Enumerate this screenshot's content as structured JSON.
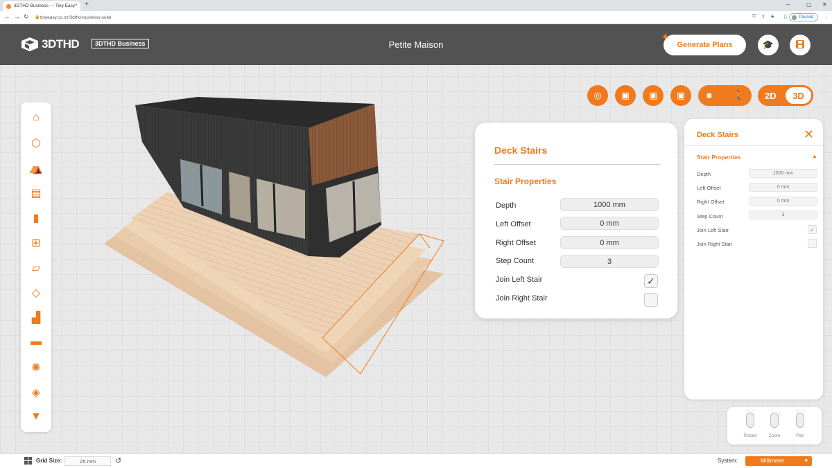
{
  "browser": {
    "tab_title": "3DTHD Business — Tiny Easy",
    "tab_close": "×",
    "new_tab": "+",
    "url": "tinyeasy.co.nz/3dthd-business-suite",
    "profile_status": "Paused",
    "win_min": "–",
    "win_max": "▢",
    "win_close": "✕"
  },
  "header": {
    "logo_text": "3DTHD",
    "badge": "3DTHD Business",
    "project_title": "Petite Maison",
    "generate_label": "Generate Plans"
  },
  "view_controls": {
    "mode_2d": "2D",
    "mode_3d": "3D"
  },
  "card": {
    "title": "Deck Stairs",
    "section": "Stair Properties",
    "rows": [
      {
        "label": "Depth",
        "value": "1000 mm"
      },
      {
        "label": "Left Offset",
        "value": "0  mm"
      },
      {
        "label": "Right Offset",
        "value": "0 mm"
      },
      {
        "label": "Step Count",
        "value": "3"
      }
    ],
    "join_left_label": "Join Left Stair",
    "join_left_checked": "✓",
    "join_right_label": "Join Right Stair"
  },
  "side_panel": {
    "title": "Deck Stairs",
    "close": "✕",
    "section": "Stair Properties",
    "caret": "▲",
    "rows": [
      {
        "label": "Depth",
        "value": "1000 mm"
      },
      {
        "label": "Left Offset",
        "value": "0 mm"
      },
      {
        "label": "Right Offset",
        "value": "0 mm"
      },
      {
        "label": "Step Count",
        "value": "3"
      }
    ],
    "join_left_label": "Join Left Stair",
    "join_left_checked": "✓",
    "join_right_label": "Join Right Stair"
  },
  "mouse_hints": {
    "rotate": "Rotate",
    "zoom": "Zoom",
    "pan": "Pan"
  },
  "status": {
    "grid_label": "Grid Size:",
    "grid_value": "25 mm",
    "system_label": "System:",
    "system_value": "Millimetre"
  },
  "colors": {
    "accent": "#f07a1e",
    "header_bg": "#525252"
  }
}
